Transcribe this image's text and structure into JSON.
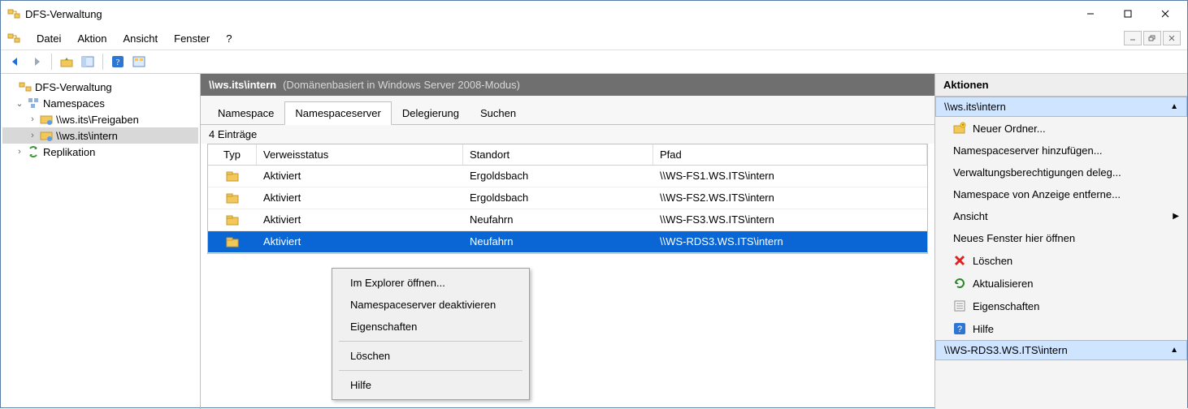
{
  "window": {
    "title": "DFS-Verwaltung"
  },
  "menu": {
    "datei": "Datei",
    "aktion": "Aktion",
    "ansicht": "Ansicht",
    "fenster": "Fenster",
    "hilfe": "?"
  },
  "tree": {
    "root": "DFS-Verwaltung",
    "namespaces": "Namespaces",
    "ns_freigaben": "\\\\ws.its\\Freigaben",
    "ns_intern": "\\\\ws.its\\intern",
    "replikation": "Replikation"
  },
  "center": {
    "title": "\\\\ws.its\\intern",
    "subtitle": "(Domänenbasiert in Windows Server 2008-Modus)",
    "tabs": {
      "namespace": "Namespace",
      "nsserver": "Namespaceserver",
      "delegierung": "Delegierung",
      "suchen": "Suchen"
    },
    "count_label": "4 Einträge",
    "columns": {
      "typ": "Typ",
      "status": "Verweisstatus",
      "standort": "Standort",
      "pfad": "Pfad"
    },
    "rows": [
      {
        "status": "Aktiviert",
        "standort": "Ergoldsbach",
        "pfad": "\\\\WS-FS1.WS.ITS\\intern"
      },
      {
        "status": "Aktiviert",
        "standort": "Ergoldsbach",
        "pfad": "\\\\WS-FS2.WS.ITS\\intern"
      },
      {
        "status": "Aktiviert",
        "standort": "Neufahrn",
        "pfad": "\\\\WS-FS3.WS.ITS\\intern"
      },
      {
        "status": "Aktiviert",
        "standort": "Neufahrn",
        "pfad": "\\\\WS-RDS3.WS.ITS\\intern"
      }
    ]
  },
  "context_menu": {
    "open_explorer": "Im Explorer öffnen...",
    "deactivate": "Namespaceserver deaktivieren",
    "properties": "Eigenschaften",
    "delete": "Löschen",
    "help": "Hilfe"
  },
  "actions": {
    "title": "Aktionen",
    "section1": "\\\\ws.its\\intern",
    "new_folder": "Neuer Ordner...",
    "add_ns": "Namespaceserver hinzufügen...",
    "deleg": "Verwaltungsberechtigungen deleg...",
    "remove_ns": "Namespace von Anzeige entferne...",
    "ansicht": "Ansicht",
    "new_window": "Neues Fenster hier öffnen",
    "delete": "Löschen",
    "refresh": "Aktualisieren",
    "properties": "Eigenschaften",
    "help": "Hilfe",
    "section2": "\\\\WS-RDS3.WS.ITS\\intern"
  }
}
